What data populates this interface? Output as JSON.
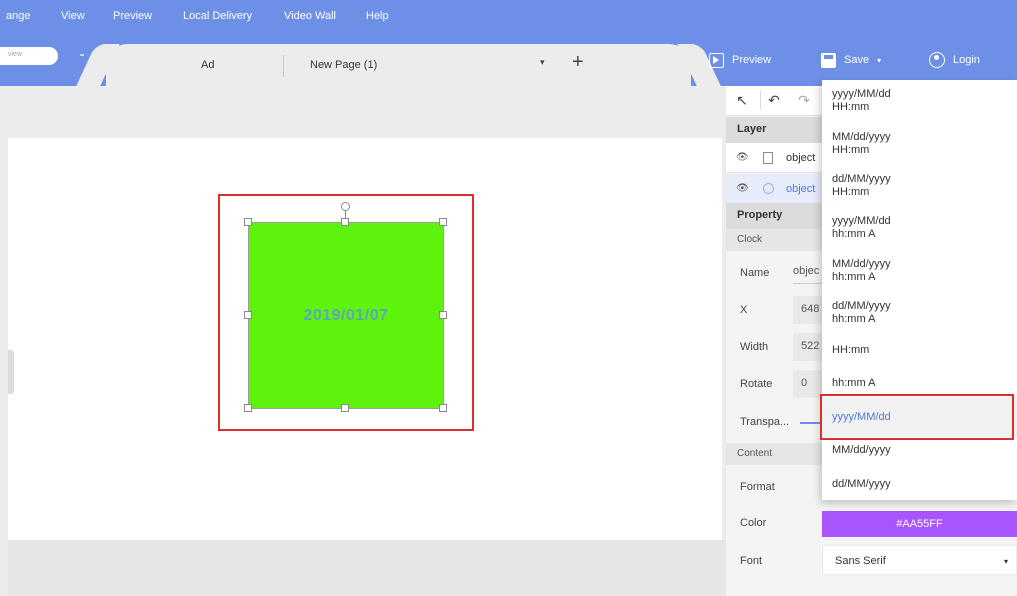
{
  "menubar": {
    "items": [
      "ange",
      "View",
      "Preview",
      "Local Delivery",
      "Video Wall",
      "Help"
    ]
  },
  "ribbon": {
    "pill_label": "view",
    "tabs": {
      "ad": "Ad",
      "page": "New Page (1)"
    },
    "dropdown_glyph": "▾",
    "add_glyph": "+",
    "preview_label": "Preview",
    "save_label": "Save",
    "login_label": "Login"
  },
  "canvas": {
    "clock_text": "2019/01/07",
    "object_color": "#5EF30C",
    "selection_outline_color": "#D9302F"
  },
  "toolbar": {
    "select_glyph": "↖",
    "undo_glyph": "↶",
    "redo_glyph": "↷"
  },
  "panel": {
    "layer_title": "Layer",
    "layers": [
      {
        "label": "object",
        "selected": false
      },
      {
        "label": "object",
        "selected": true
      }
    ],
    "eye_glyph": "👁",
    "property_title": "Property",
    "clock_subtitle": "Clock",
    "content_subtitle": "Content",
    "props": {
      "name_label": "Name",
      "name_value": "objec",
      "x_label": "X",
      "x_value": "648",
      "width_label": "Width",
      "width_value": "522",
      "rotate_label": "Rotate",
      "rotate_value": "0",
      "transparency_label": "Transpa...",
      "format_label": "Format",
      "color_label": "Color",
      "color_value": "#AA55FF",
      "font_label": "Font",
      "font_value": "Sans Serif"
    }
  },
  "format_dropdown": {
    "options": [
      {
        "line1": "yyyy/MM/dd",
        "line2": "HH:mm"
      },
      {
        "line1": "MM/dd/yyyy",
        "line2": "HH:mm"
      },
      {
        "line1": "dd/MM/yyyy",
        "line2": "HH:mm"
      },
      {
        "line1": "yyyy/MM/dd",
        "line2": "hh:mm A"
      },
      {
        "line1": "MM/dd/yyyy",
        "line2": "hh:mm A"
      },
      {
        "line1": "dd/MM/yyyy",
        "line2": "hh:mm A"
      },
      {
        "line1": "HH:mm",
        "line2": ""
      },
      {
        "line1": "hh:mm A",
        "line2": ""
      },
      {
        "line1": "yyyy/MM/dd",
        "line2": ""
      },
      {
        "line1": "MM/dd/yyyy",
        "line2": ""
      },
      {
        "line1": "dd/MM/yyyy",
        "line2": ""
      }
    ],
    "selected_value": "yyyy/MM/dd"
  },
  "colors": {
    "menubar": "#6D8FE6",
    "accent": "#4F7AE0",
    "highlight": "#D9302F",
    "swatch": "#A855FF"
  }
}
